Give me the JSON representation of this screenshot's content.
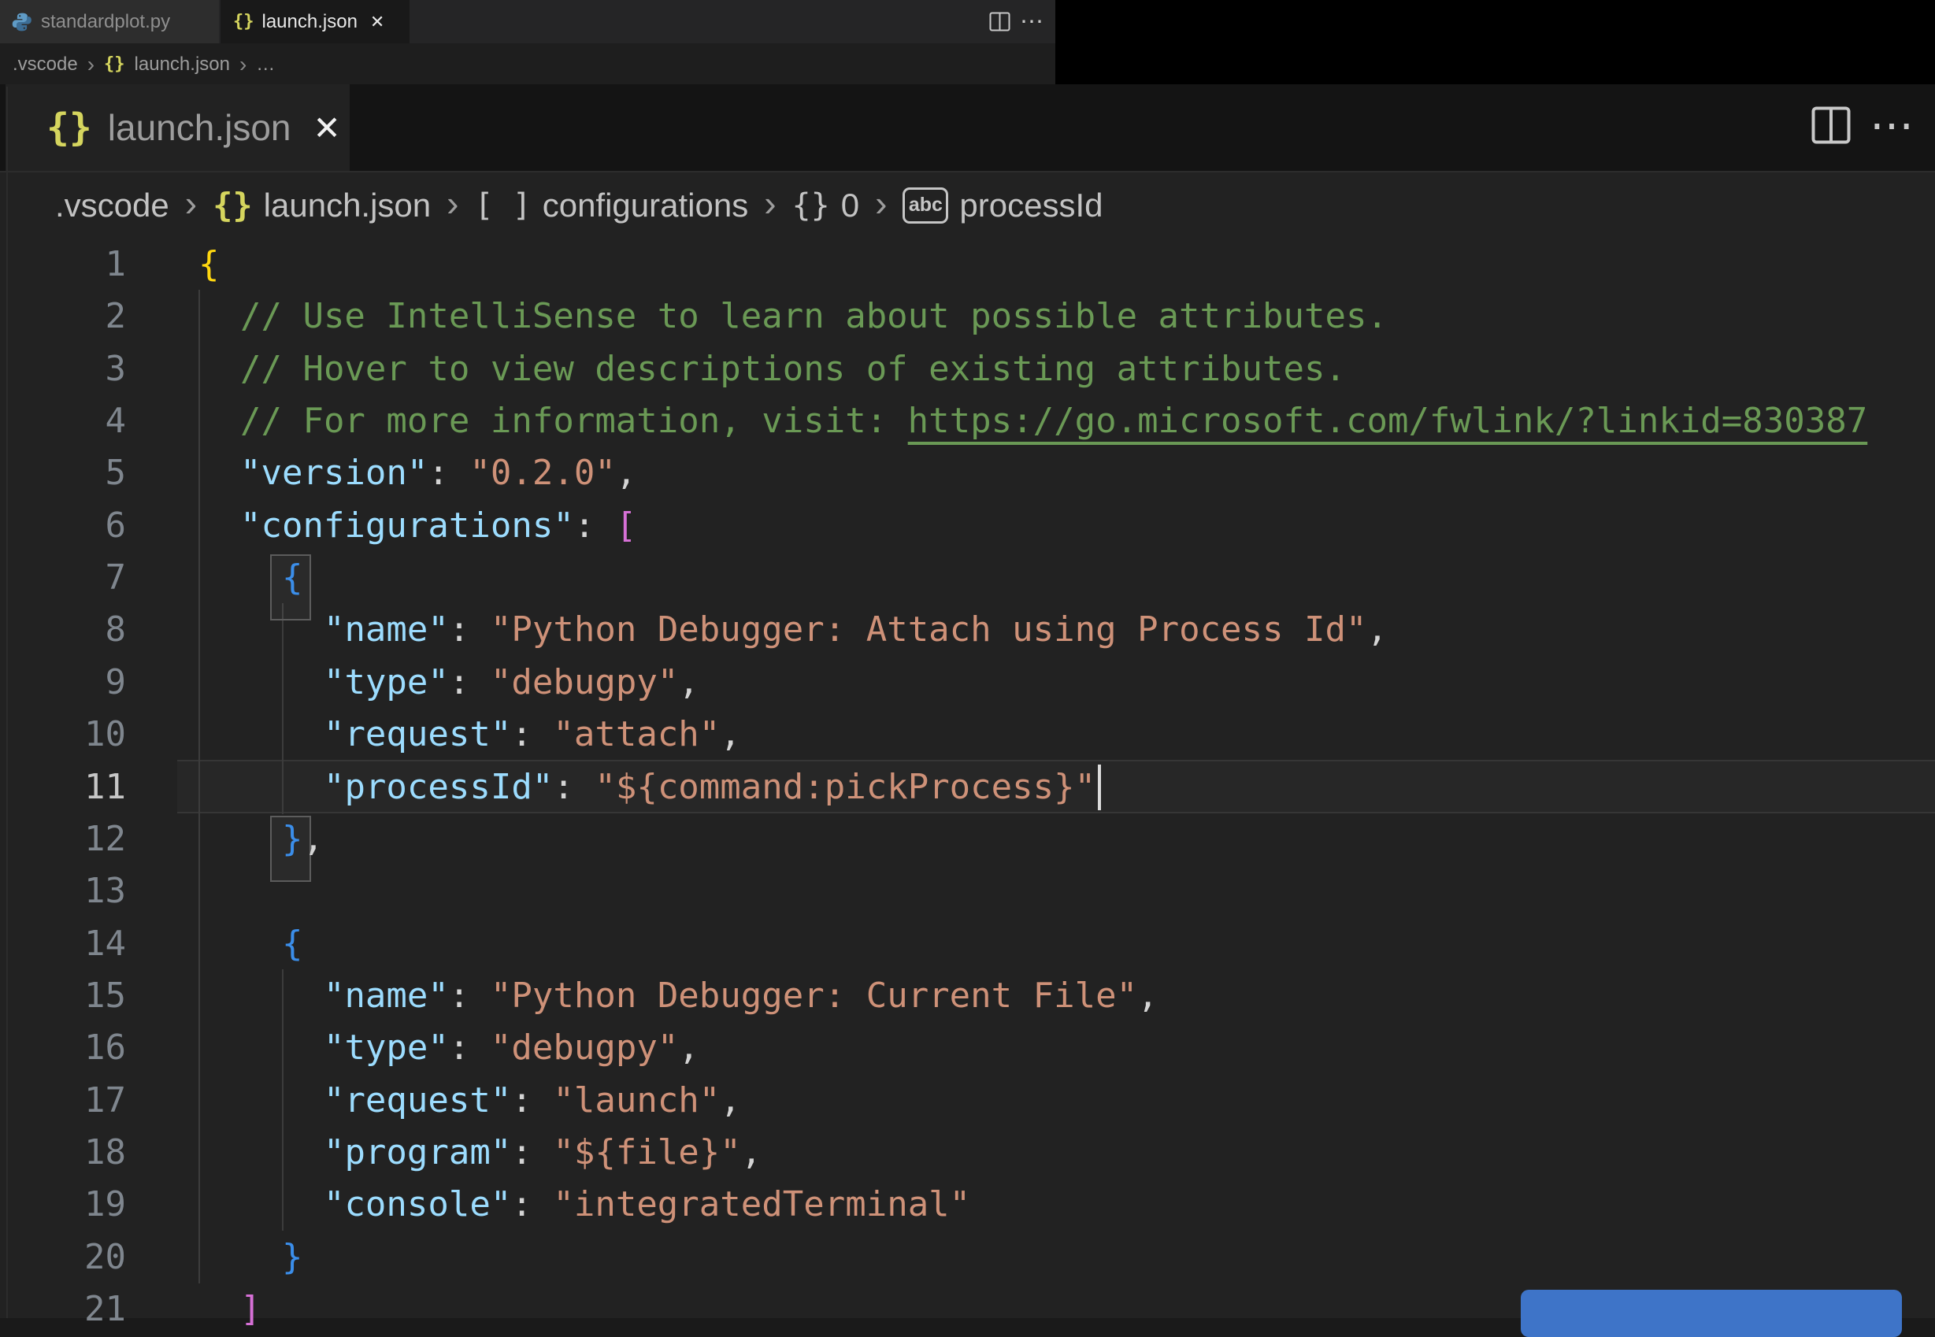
{
  "colors": {
    "editor_background": "#222222",
    "accent_button_blue": "#3E74C8",
    "json_icon_yellow": "#D5D55E",
    "bracket_gold": "#FFD710",
    "bracket_pink": "#D670D6",
    "bracket_blue": "#3B8EEA",
    "key_blue": "#9CDCFE",
    "string_orange": "#CE9178",
    "comment_green": "#6A9955"
  },
  "small_tabbar": {
    "tab_python": {
      "label": "standardplot.py",
      "icon": "python"
    },
    "tab_json": {
      "label": "launch.json",
      "icon": "json-braces",
      "braces_glyph": "{}",
      "close_glyph": "✕"
    },
    "actions": {
      "more_glyph": "⋯"
    }
  },
  "small_breadcrumb": {
    "folder": ".vscode",
    "separator": "›",
    "file_icon_glyph": "{}",
    "file": "launch.json",
    "collapsed": "…"
  },
  "big_editor": {
    "tab": {
      "icon_glyph": "{}",
      "label": "launch.json",
      "close_glyph": "✕"
    },
    "actions": {
      "more_glyph": "⋯"
    },
    "breadcrumb": {
      "separator": "›",
      "items": [
        {
          "label": ".vscode",
          "icon": null
        },
        {
          "label": "launch.json",
          "icon": "braces-yellow",
          "icon_glyph": "{}"
        },
        {
          "label": "configurations",
          "icon": "array",
          "icon_glyph": "[ ]"
        },
        {
          "label": "0",
          "icon": "braces-gray",
          "icon_glyph": "{}"
        },
        {
          "label": "processId",
          "icon": "abc",
          "icon_glyph": "abc"
        }
      ]
    },
    "code": {
      "active_line": 11,
      "lines": [
        {
          "num": 1,
          "tokens": [
            {
              "t": "{",
              "c": "b1"
            }
          ]
        },
        {
          "num": 2,
          "tokens": [
            {
              "t": "  ",
              "c": "plain"
            },
            {
              "t": "// Use IntelliSense to learn about possible attributes.",
              "c": "comment"
            }
          ]
        },
        {
          "num": 3,
          "tokens": [
            {
              "t": "  ",
              "c": "plain"
            },
            {
              "t": "// Hover to view descriptions of existing attributes.",
              "c": "comment"
            }
          ]
        },
        {
          "num": 4,
          "tokens": [
            {
              "t": "  ",
              "c": "plain"
            },
            {
              "t": "// For more information, visit: ",
              "c": "comment"
            },
            {
              "t": "https://go.microsoft.com/fwlink/?linkid=830387",
              "c": "link"
            }
          ]
        },
        {
          "num": 5,
          "tokens": [
            {
              "t": "  ",
              "c": "plain"
            },
            {
              "t": "\"version\"",
              "c": "key"
            },
            {
              "t": ": ",
              "c": "plain"
            },
            {
              "t": "\"0.2.0\"",
              "c": "str"
            },
            {
              "t": ",",
              "c": "plain"
            }
          ]
        },
        {
          "num": 6,
          "tokens": [
            {
              "t": "  ",
              "c": "plain"
            },
            {
              "t": "\"configurations\"",
              "c": "key"
            },
            {
              "t": ": ",
              "c": "plain"
            },
            {
              "t": "[",
              "c": "b2"
            }
          ]
        },
        {
          "num": 7,
          "tokens": [
            {
              "t": "    ",
              "c": "plain"
            },
            {
              "t": "{",
              "c": "b3"
            }
          ]
        },
        {
          "num": 8,
          "tokens": [
            {
              "t": "      ",
              "c": "plain"
            },
            {
              "t": "\"name\"",
              "c": "key"
            },
            {
              "t": ": ",
              "c": "plain"
            },
            {
              "t": "\"Python Debugger: Attach using Process Id\"",
              "c": "str"
            },
            {
              "t": ",",
              "c": "plain"
            }
          ]
        },
        {
          "num": 9,
          "tokens": [
            {
              "t": "      ",
              "c": "plain"
            },
            {
              "t": "\"type\"",
              "c": "key"
            },
            {
              "t": ": ",
              "c": "plain"
            },
            {
              "t": "\"debugpy\"",
              "c": "str"
            },
            {
              "t": ",",
              "c": "plain"
            }
          ]
        },
        {
          "num": 10,
          "tokens": [
            {
              "t": "      ",
              "c": "plain"
            },
            {
              "t": "\"request\"",
              "c": "key"
            },
            {
              "t": ": ",
              "c": "plain"
            },
            {
              "t": "\"attach\"",
              "c": "str"
            },
            {
              "t": ",",
              "c": "plain"
            }
          ]
        },
        {
          "num": 11,
          "tokens": [
            {
              "t": "      ",
              "c": "plain"
            },
            {
              "t": "\"processId\"",
              "c": "key"
            },
            {
              "t": ": ",
              "c": "plain"
            },
            {
              "t": "\"${command:pickProcess}\"",
              "c": "str"
            }
          ]
        },
        {
          "num": 12,
          "tokens": [
            {
              "t": "    ",
              "c": "plain"
            },
            {
              "t": "}",
              "c": "b3"
            },
            {
              "t": ",",
              "c": "plain"
            }
          ]
        },
        {
          "num": 13,
          "tokens": []
        },
        {
          "num": 14,
          "tokens": [
            {
              "t": "    ",
              "c": "plain"
            },
            {
              "t": "{",
              "c": "b3"
            }
          ]
        },
        {
          "num": 15,
          "tokens": [
            {
              "t": "      ",
              "c": "plain"
            },
            {
              "t": "\"name\"",
              "c": "key"
            },
            {
              "t": ": ",
              "c": "plain"
            },
            {
              "t": "\"Python Debugger: Current File\"",
              "c": "str"
            },
            {
              "t": ",",
              "c": "plain"
            }
          ]
        },
        {
          "num": 16,
          "tokens": [
            {
              "t": "      ",
              "c": "plain"
            },
            {
              "t": "\"type\"",
              "c": "key"
            },
            {
              "t": ": ",
              "c": "plain"
            },
            {
              "t": "\"debugpy\"",
              "c": "str"
            },
            {
              "t": ",",
              "c": "plain"
            }
          ]
        },
        {
          "num": 17,
          "tokens": [
            {
              "t": "      ",
              "c": "plain"
            },
            {
              "t": "\"request\"",
              "c": "key"
            },
            {
              "t": ": ",
              "c": "plain"
            },
            {
              "t": "\"launch\"",
              "c": "str"
            },
            {
              "t": ",",
              "c": "plain"
            }
          ]
        },
        {
          "num": 18,
          "tokens": [
            {
              "t": "      ",
              "c": "plain"
            },
            {
              "t": "\"program\"",
              "c": "key"
            },
            {
              "t": ": ",
              "c": "plain"
            },
            {
              "t": "\"${file}\"",
              "c": "str"
            },
            {
              "t": ",",
              "c": "plain"
            }
          ]
        },
        {
          "num": 19,
          "tokens": [
            {
              "t": "      ",
              "c": "plain"
            },
            {
              "t": "\"console\"",
              "c": "key"
            },
            {
              "t": ": ",
              "c": "plain"
            },
            {
              "t": "\"integratedTerminal\"",
              "c": "str"
            }
          ]
        },
        {
          "num": 20,
          "tokens": [
            {
              "t": "    ",
              "c": "plain"
            },
            {
              "t": "}",
              "c": "b3"
            }
          ]
        },
        {
          "num": 21,
          "tokens": [
            {
              "t": "  ",
              "c": "plain"
            },
            {
              "t": "]",
              "c": "b2"
            }
          ]
        }
      ]
    }
  }
}
